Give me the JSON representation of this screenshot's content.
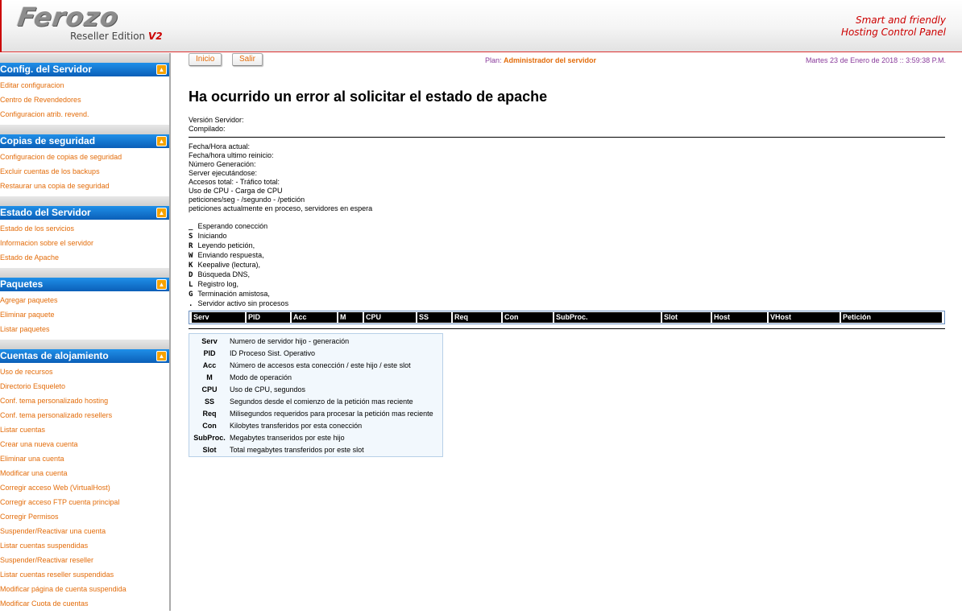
{
  "header": {
    "logo_main": "Ferozo",
    "logo_sub": "Reseller Edition",
    "logo_version": "V2",
    "tagline_1": "Smart and friendly",
    "tagline_2": "Hosting Control Panel",
    "accent_color": "#cc0000"
  },
  "sidebar": {
    "sections": [
      {
        "title": "Config. del Servidor",
        "items": [
          "Editar configuracion",
          "Centro de Revendedores",
          "Configuracion atrib. revend."
        ]
      },
      {
        "title": "Copias de seguridad",
        "items": [
          "Configuracion de copias de seguridad",
          "Excluir cuentas de los backups",
          "Restaurar una copia de seguridad"
        ]
      },
      {
        "title": "Estado del Servidor",
        "items": [
          "Estado de los servicios",
          "Informacion sobre el servidor",
          "Estado de Apache"
        ]
      },
      {
        "title": "Paquetes",
        "items": [
          "Agregar paquetes",
          "Eliminar paquete",
          "Listar paquetes"
        ]
      },
      {
        "title": "Cuentas de alojamiento",
        "items": [
          "Uso de recursos",
          "Directorio Esqueleto",
          "Conf. tema personalizado hosting",
          "Conf. tema personalizado resellers",
          "Listar cuentas",
          "Crear una nueva cuenta",
          "Eliminar una cuenta",
          "Modificar una cuenta",
          "Corregir acceso Web (VirtualHost)",
          "Corregir acceso FTP cuenta principal",
          "Corregir Permisos",
          "Suspender/Reactivar una cuenta",
          "Listar cuentas suspendidas",
          "Suspender/Reactivar reseller",
          "Listar cuentas reseller suspendidas",
          "Modificar página de cuenta suspendida",
          "Modificar Cuota de cuentas"
        ]
      }
    ],
    "collapse_icon": "chevron-up-icon",
    "link_color": "#e36c0a",
    "header_color": "#0b6fd0"
  },
  "toolbar": {
    "inicio": "Inicio",
    "salir": "Salir",
    "plan_label": "Plan:",
    "plan_value": "Administrador del servidor",
    "datetime": "Martes 23 de Enero de 2018 :: 3:59:38 P.M."
  },
  "main": {
    "title": "Ha ocurrido un error al solicitar el estado de apache",
    "version_lines": [
      "Versión Servidor:",
      "Compilado:"
    ],
    "info_lines": [
      "Fecha/Hora actual:",
      "Fecha/hora ultimo reinicio:",
      "Número Generación:",
      "Server ejecutándose:",
      "Accesos total: - Tráfico total:",
      "Uso de CPU - Carga de CPU",
      "peticiones/seg - /segundo - /petición",
      "peticiones actualmente en proceso, servidores en espera"
    ],
    "legend": [
      {
        "k": "_",
        "t": "Esperando conección"
      },
      {
        "k": "S",
        "t": "Iniciando"
      },
      {
        "k": "R",
        "t": "Leyendo petición,"
      },
      {
        "k": "W",
        "t": "Enviando respuesta,"
      },
      {
        "k": "K",
        "t": "Keepalive (lectura),"
      },
      {
        "k": "D",
        "t": "Búsqueda DNS,"
      },
      {
        "k": "L",
        "t": "Registro log,"
      },
      {
        "k": "G",
        "t": "Terminación amistosa,"
      },
      {
        "k": ".",
        "t": "Servidor activo sin procesos"
      }
    ],
    "table_headers": [
      "Serv",
      "PID",
      "Acc",
      "M",
      "CPU",
      "SS",
      "Req",
      "Con",
      "SubProc.",
      "Slot",
      "Host",
      "VHost",
      "Petición"
    ],
    "key": [
      {
        "k": "Serv",
        "t": "Numero de servidor hijo - generación"
      },
      {
        "k": "PID",
        "t": "ID Proceso Sist. Operativo"
      },
      {
        "k": "Acc",
        "t": "Número de accesos esta conección / este hijo / este slot"
      },
      {
        "k": "M",
        "t": "Modo de operación"
      },
      {
        "k": "CPU",
        "t": "Uso de CPU, segundos"
      },
      {
        "k": "SS",
        "t": "Segundos desde el comienzo de la petición mas reciente"
      },
      {
        "k": "Req",
        "t": "Milisegundos requeridos para procesar la petición mas reciente"
      },
      {
        "k": "Con",
        "t": "Kilobytes transferidos por esta conección"
      },
      {
        "k": "SubProc.",
        "t": "Megabytes transeridos por este hijo"
      },
      {
        "k": "Slot",
        "t": "Total megabytes transferidos por este slot"
      }
    ]
  }
}
